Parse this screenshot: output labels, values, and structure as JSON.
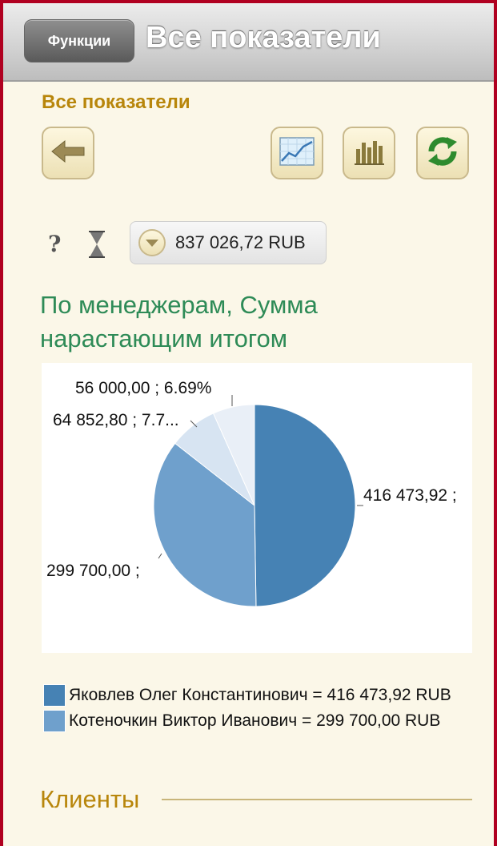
{
  "topbar": {
    "functions_label": "Функции",
    "title": "Все показатели"
  },
  "section": {
    "title": "Все показатели"
  },
  "toolbar": {
    "back_icon": "back-arrow-icon",
    "line_chart_icon": "line-chart-icon",
    "bar_chart_icon": "bar-chart-icon",
    "refresh_icon": "refresh-icon"
  },
  "indicators": {
    "help_glyph": "?",
    "hourglass_icon": "hourglass-icon"
  },
  "amount": {
    "value": "837 026,72 RUB"
  },
  "chart": {
    "title": "По менеджерам, Сумма нарастающим итогом"
  },
  "chart_data": {
    "type": "pie",
    "title": "По менеджерам, Сумма нарастающим итогом",
    "slices": [
      {
        "name": "Яковлев Олег Константинович",
        "value": 416473.92,
        "label": "416 473,92 ;",
        "color": "#4682b4"
      },
      {
        "name": "Котеночкин Виктор Иванович",
        "value": 299700.0,
        "label": "299 700,00 ;",
        "color": "#6fa0cc"
      },
      {
        "name": "",
        "value": 64852.8,
        "label": "64 852,80 ; 7.7...",
        "color": "#d7e4f2"
      },
      {
        "name": "",
        "value": 56000.0,
        "label": "56 000,00 ; 6.69%",
        "color": "#e9eff7"
      }
    ]
  },
  "legend": {
    "items": [
      {
        "text": "Яковлев Олег Константинович = 416 473,92 RUB",
        "color": "#4682b4"
      },
      {
        "text": "Котеночкин Виктор Иванович = 299 700,00 RUB",
        "color": "#6fa0cc"
      }
    ]
  },
  "clients": {
    "title": "Клиенты"
  },
  "colors": {
    "accent_gold": "#b8860b",
    "chart_title_green": "#2e8b57",
    "frame_red": "#b00020"
  }
}
